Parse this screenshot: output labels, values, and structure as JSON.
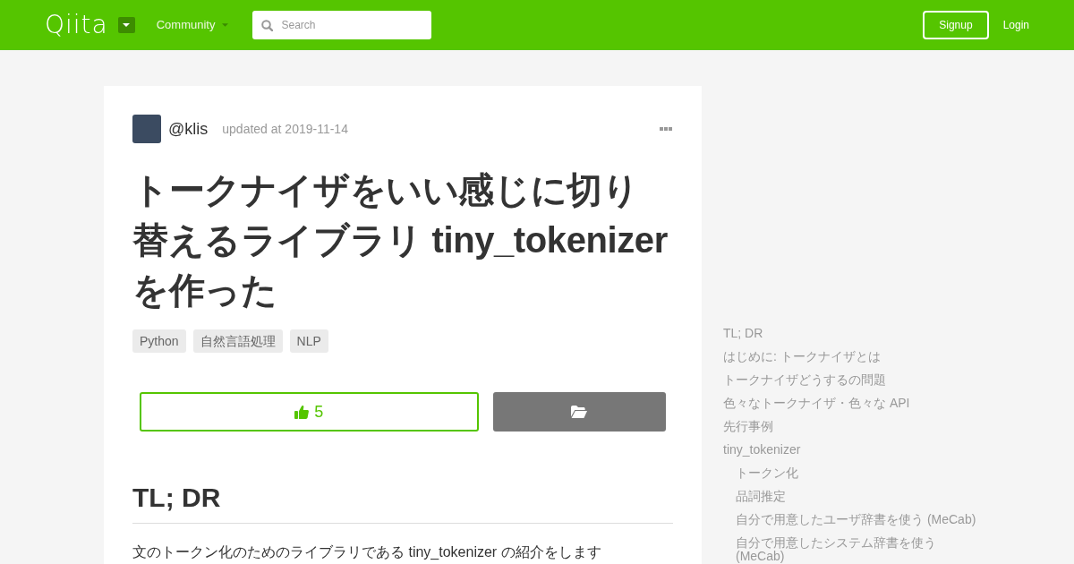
{
  "header": {
    "logo": "Qiita",
    "nav": [
      {
        "label": "Community"
      }
    ],
    "search": {
      "placeholder": "Search"
    },
    "buttons": [
      {
        "label": "Signup",
        "kind": "outline"
      },
      {
        "label": "Login",
        "kind": "link"
      }
    ]
  },
  "article": {
    "author": "@klis",
    "updated": "updated at 2019-11-14",
    "title": "トークナイザをいい感じに切り替えるライブラリ tiny_tokenizer を作った",
    "tags": [
      "Python",
      "自然言語処理",
      "NLP"
    ],
    "like_count": "5",
    "section": {
      "heading": "TL; DR",
      "paragraph": {
        "before": "文のトークン化のためのライブラリである ",
        "link": "tiny_tokenizer",
        "after": " の紹介をします"
      }
    }
  },
  "toc": [
    {
      "label": "TL; DR"
    },
    {
      "label": "はじめに: トークナイザとは"
    },
    {
      "label": "トークナイザどうするの問題"
    },
    {
      "label": "色々なトークナイザ・色々な API"
    },
    {
      "label": "先行事例"
    },
    {
      "label": "tiny_tokenizer",
      "children": [
        {
          "label": "トークン化"
        },
        {
          "label": "品詞推定"
        },
        {
          "label": "自分で用意したユーザ辞書を使う (MeCab)"
        },
        {
          "label": "自分で用意したシステム辞書を使う (MeCab)"
        }
      ]
    }
  ]
}
